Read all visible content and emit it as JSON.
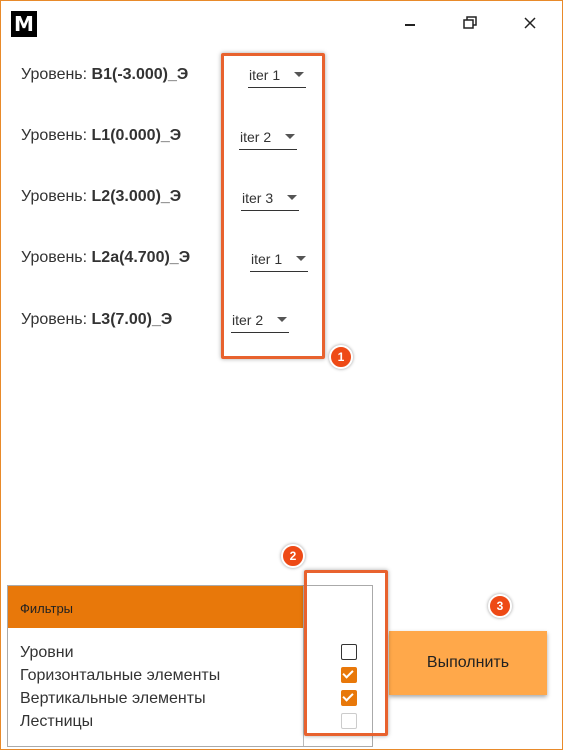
{
  "app": {
    "logo_letter": "M"
  },
  "levels": [
    {
      "prefix": "Уровень: ",
      "code": "B1(-3.000)_Э",
      "iteration": "iter 1"
    },
    {
      "prefix": "Уровень: ",
      "code": "L1(0.000)_Э",
      "iteration": "iter 2"
    },
    {
      "prefix": "Уровень: ",
      "code": "L2(3.000)_Э",
      "iteration": "iter 3"
    },
    {
      "prefix": "Уровень: ",
      "code": "L2a(4.700)_Э",
      "iteration": "iter 1"
    },
    {
      "prefix": "Уровень: ",
      "code": "L3(7.00)_Э",
      "iteration": "iter 2"
    }
  ],
  "filters": {
    "title": "Фильтры",
    "items": [
      {
        "label": "Уровни",
        "checked": false,
        "enabled": true
      },
      {
        "label": "Горизонтальные элементы",
        "checked": true,
        "enabled": true
      },
      {
        "label": "Вертикальные элементы",
        "checked": true,
        "enabled": true
      },
      {
        "label": "Лестницы",
        "checked": false,
        "enabled": false
      }
    ]
  },
  "run_button": "Выполнить",
  "annotations": [
    "1",
    "2",
    "3"
  ],
  "colors": {
    "accent": "#e8780a",
    "button": "#ffa84a",
    "callout": "#e8622e"
  }
}
